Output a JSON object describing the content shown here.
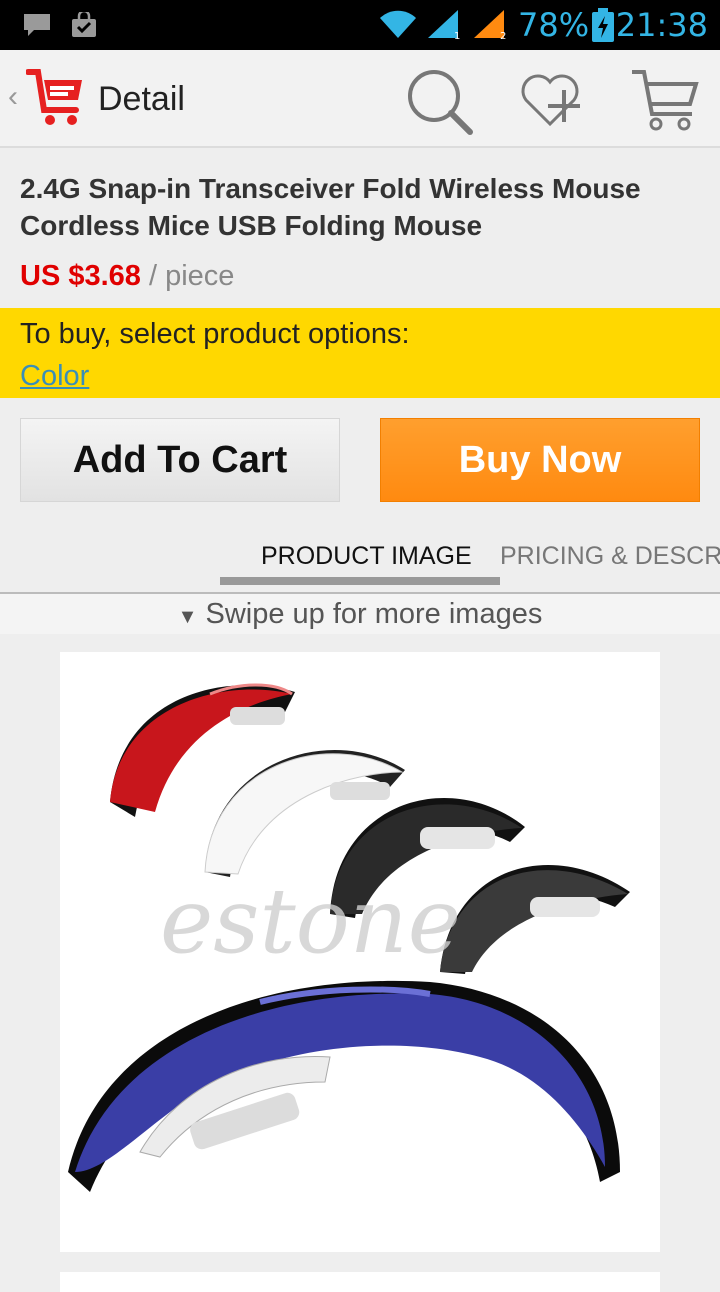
{
  "status_bar": {
    "battery_percent": "78%",
    "time": "21:38",
    "icons": [
      "message-icon",
      "bag-check-icon",
      "wifi-icon",
      "signal-1-icon",
      "signal-2-icon",
      "battery-charging-icon"
    ]
  },
  "action_bar": {
    "title": "Detail",
    "icons": [
      "back-chevron-icon",
      "cart-logo-icon",
      "search-icon",
      "wishlist-add-icon",
      "cart-icon"
    ]
  },
  "product": {
    "title": "2.4G Snap-in Transceiver Fold Wireless Mouse Cordless Mice USB Folding Mouse",
    "price": "US $3.68",
    "unit": "/ piece"
  },
  "options": {
    "prompt": "To buy, select product options:",
    "color_link": "Color"
  },
  "buttons": {
    "add_to_cart": "Add To Cart",
    "buy_now": "Buy Now"
  },
  "tabs": [
    {
      "label": "PRODUCT IMAGE",
      "active": true
    },
    {
      "label": "PRICING & DESCRIPTION",
      "active": false
    }
  ],
  "swipe_hint": "Swipe up for more images",
  "image_watermark": "estone",
  "colors": {
    "accent": "#ff8a10",
    "price": "#e00000",
    "options_bg": "#ffd800",
    "status_text": "#33b5e5"
  }
}
